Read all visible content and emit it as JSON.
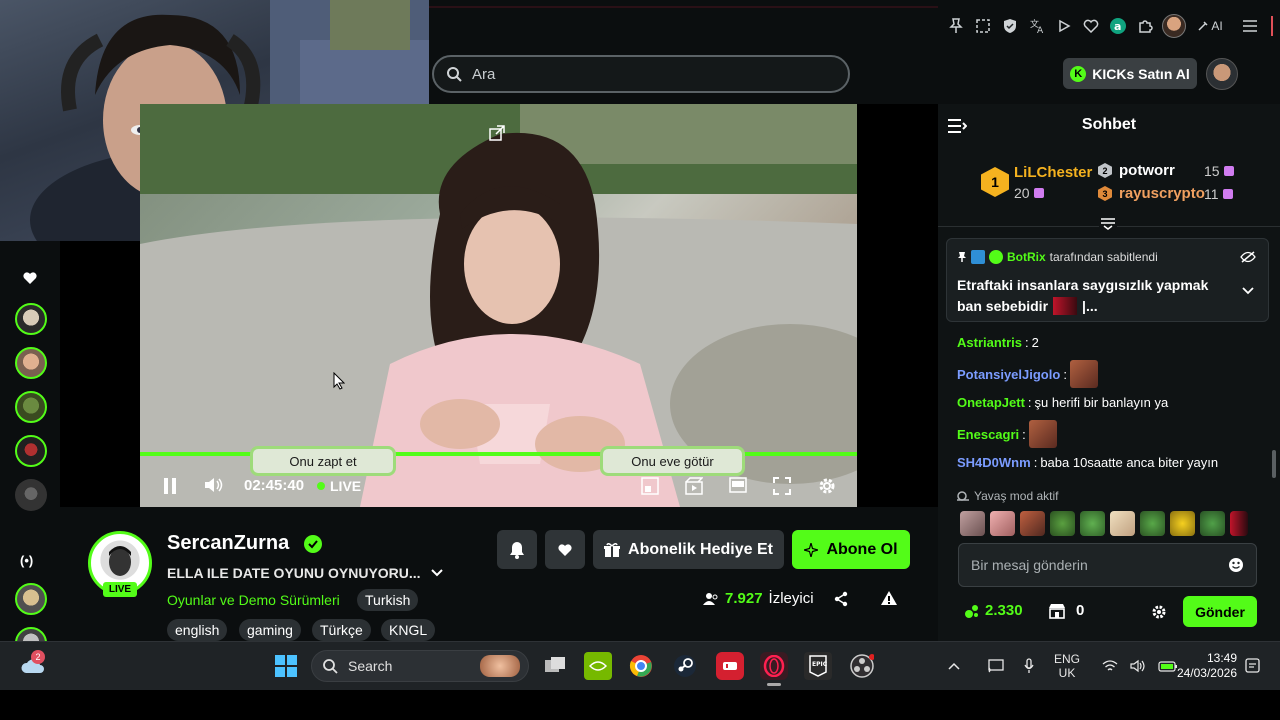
{
  "search": {
    "placeholder": "Ara"
  },
  "header": {
    "kicks_button": "KICKs Satın Al",
    "ai_label": "AI"
  },
  "player": {
    "time": "02:45:40",
    "live_label": "LIVE",
    "progress_fraction": 1.0,
    "overlay_buttons": [
      "Onu zapt et",
      "Onu eve götür"
    ]
  },
  "channel": {
    "name": "SercanZurna",
    "live_badge": "LIVE",
    "title": "ELLA ILE DATE OYUNU OYNUYORU...",
    "category": "Oyunlar ve Demo Sürümleri",
    "language_tag": "Turkish",
    "tags": [
      "english",
      "gaming",
      "Türkçe",
      "KNGL"
    ],
    "gift_button": "Abonelik Hediye Et",
    "subscribe_button": "Abone Ol",
    "viewer_count": "7.927",
    "viewer_label": "İzleyici"
  },
  "chat": {
    "title": "Sohbet",
    "leaderboard": {
      "first": {
        "rank": "1",
        "name": "LiLChester",
        "count": "20"
      },
      "second": {
        "rank": "2",
        "name": "potworr",
        "count": "15"
      },
      "third": {
        "rank": "3",
        "name": "rayuscrypto",
        "count": "11"
      }
    },
    "pinned": {
      "pinned_by": "BotRix",
      "pinned_suffix": "tarafından sabitlendi",
      "message_line1": "Etraftaki insanlara saygısızlık yapmak",
      "message_line2": "ban sebebidir",
      "message_tail": "|..."
    },
    "messages": [
      {
        "user": "Astriantris",
        "text": "2",
        "color": "#53fc18"
      },
      {
        "user": "PotansiyelJigolo",
        "text": "",
        "color": "#7b9cff"
      },
      {
        "user": "OnetapJett",
        "text": "şu herifi bir banlayın ya",
        "color": "#53fc18"
      },
      {
        "user": "Enescagri",
        "text": "",
        "color": "#53fc18"
      },
      {
        "user": "SH4D0Wnm",
        "text": "baba 10saatte anca biter yayın",
        "color": "#7b9cff"
      }
    ],
    "slow_mode": "Yavaş mod aktif",
    "input_placeholder": "Bir mesaj gönderin",
    "points": "2.330",
    "store_count": "0",
    "send_button": "Gönder"
  },
  "taskbar": {
    "search_label": "Search",
    "weather_badge": "2",
    "language_line1": "ENG",
    "language_line2": "UK",
    "time": "13:49",
    "date": "24/03/2026"
  },
  "colors": {
    "accent": "#53fc18",
    "background": "#0b0e0f",
    "chat_background": "#0f1314",
    "user_blue": "#7b9cff"
  }
}
